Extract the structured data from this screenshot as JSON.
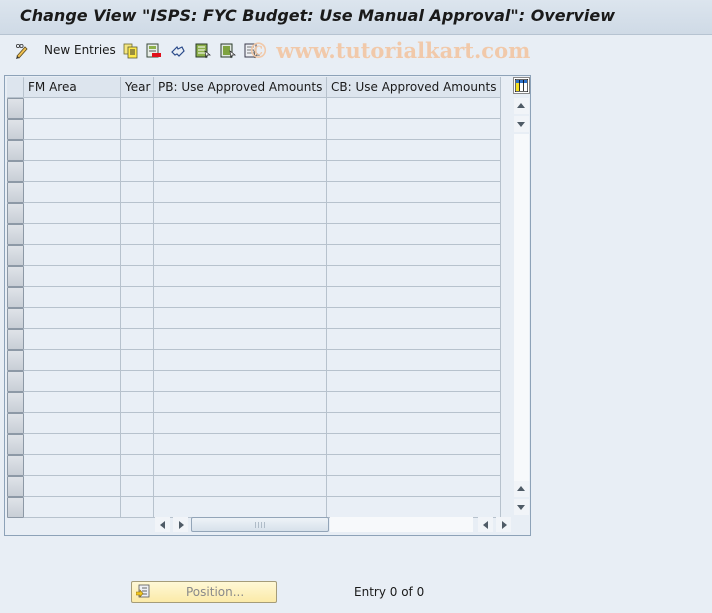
{
  "window": {
    "title": "Change View \"ISPS: FYC Budget: Use Manual Approval\": Overview"
  },
  "toolbar": {
    "items": [
      {
        "name": "display-change-icon",
        "label": ""
      },
      {
        "name": "new-entries",
        "label": "New Entries"
      },
      {
        "name": "copy-as-icon",
        "label": ""
      },
      {
        "name": "delete-icon",
        "label": ""
      },
      {
        "name": "undo-change-icon",
        "label": ""
      },
      {
        "name": "select-all-icon",
        "label": ""
      },
      {
        "name": "select-block-icon",
        "label": ""
      },
      {
        "name": "deselect-all-icon",
        "label": ""
      }
    ],
    "watermark": "© www.tutorialkart.com"
  },
  "table": {
    "columns": [
      {
        "label": "FM Area"
      },
      {
        "label": "Year"
      },
      {
        "label": "PB: Use Approved Amounts"
      },
      {
        "label": "CB: Use Approved Amounts"
      }
    ],
    "rows": [
      [
        "",
        "",
        "",
        ""
      ],
      [
        "",
        "",
        "",
        ""
      ],
      [
        "",
        "",
        "",
        ""
      ],
      [
        "",
        "",
        "",
        ""
      ],
      [
        "",
        "",
        "",
        ""
      ],
      [
        "",
        "",
        "",
        ""
      ],
      [
        "",
        "",
        "",
        ""
      ],
      [
        "",
        "",
        "",
        ""
      ],
      [
        "",
        "",
        "",
        ""
      ],
      [
        "",
        "",
        "",
        ""
      ],
      [
        "",
        "",
        "",
        ""
      ],
      [
        "",
        "",
        "",
        ""
      ],
      [
        "",
        "",
        "",
        ""
      ],
      [
        "",
        "",
        "",
        ""
      ],
      [
        "",
        "",
        "",
        ""
      ],
      [
        "",
        "",
        "",
        ""
      ],
      [
        "",
        "",
        "",
        ""
      ],
      [
        "",
        "",
        "",
        ""
      ],
      [
        "",
        "",
        "",
        ""
      ],
      [
        "",
        "",
        "",
        ""
      ]
    ]
  },
  "footer": {
    "position_label": "Position...",
    "entry_text": "Entry 0 of 0"
  },
  "colors": {
    "background": "#e8eef5",
    "position_button": "#fbeaa8",
    "watermark": "#f2c8a6"
  }
}
